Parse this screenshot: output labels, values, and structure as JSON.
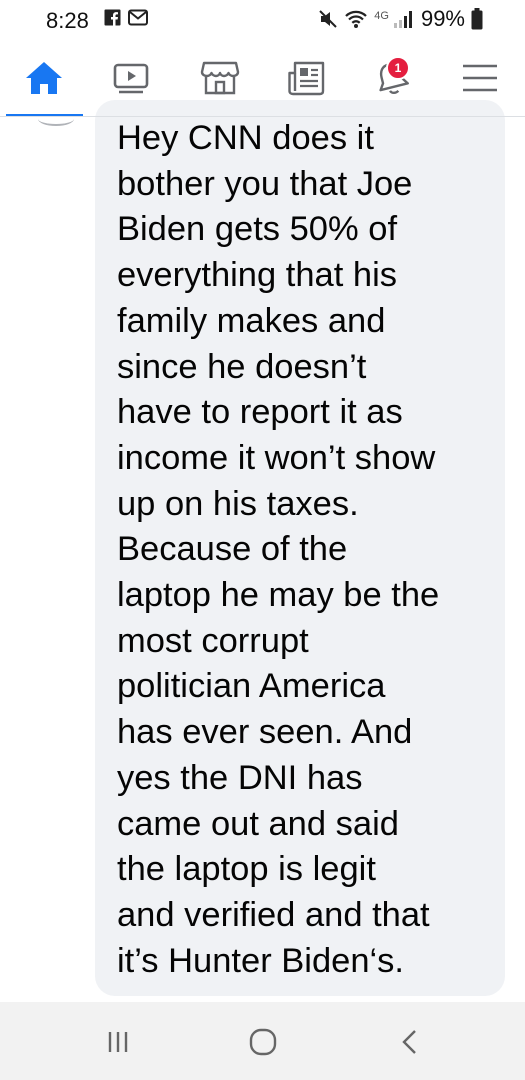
{
  "status_bar": {
    "time": "8:28",
    "network": "4G",
    "battery": "99%",
    "left_icons": [
      "facebook-icon",
      "mail-icon"
    ],
    "right_icons": [
      "mute-icon",
      "wifi-icon",
      "signal-icon",
      "battery-icon"
    ]
  },
  "nav": {
    "items": [
      {
        "name": "home",
        "icon": "home-icon",
        "active": true
      },
      {
        "name": "watch",
        "icon": "video-icon",
        "active": false
      },
      {
        "name": "marketplace",
        "icon": "store-icon",
        "active": false
      },
      {
        "name": "news",
        "icon": "news-icon",
        "active": false
      },
      {
        "name": "notifications",
        "icon": "bell-icon",
        "active": false,
        "badge": "1"
      },
      {
        "name": "menu",
        "icon": "hamburger-icon",
        "active": false
      }
    ],
    "accent": "#1877f2",
    "badge_color": "#e41e3f"
  },
  "comment": {
    "text": "Hey CNN does it\nbother you that Joe\nBiden gets 50% of\neverything that his\nfamily makes and\nsince he doesn’t\nhave to report it as\nincome it won’t show\nup on his taxes.\nBecause of the\nlaptop he may be the\nmost corrupt\npolitician America\nhas ever seen. And\nyes the DNI has\ncame out and said\nthe laptop is legit\nand verified and that\nit’s Hunter Biden‘s.",
    "bubble_color": "#f0f2f5"
  },
  "android_nav": {
    "buttons": [
      "recents-icon",
      "home-circle-icon",
      "back-icon"
    ]
  }
}
